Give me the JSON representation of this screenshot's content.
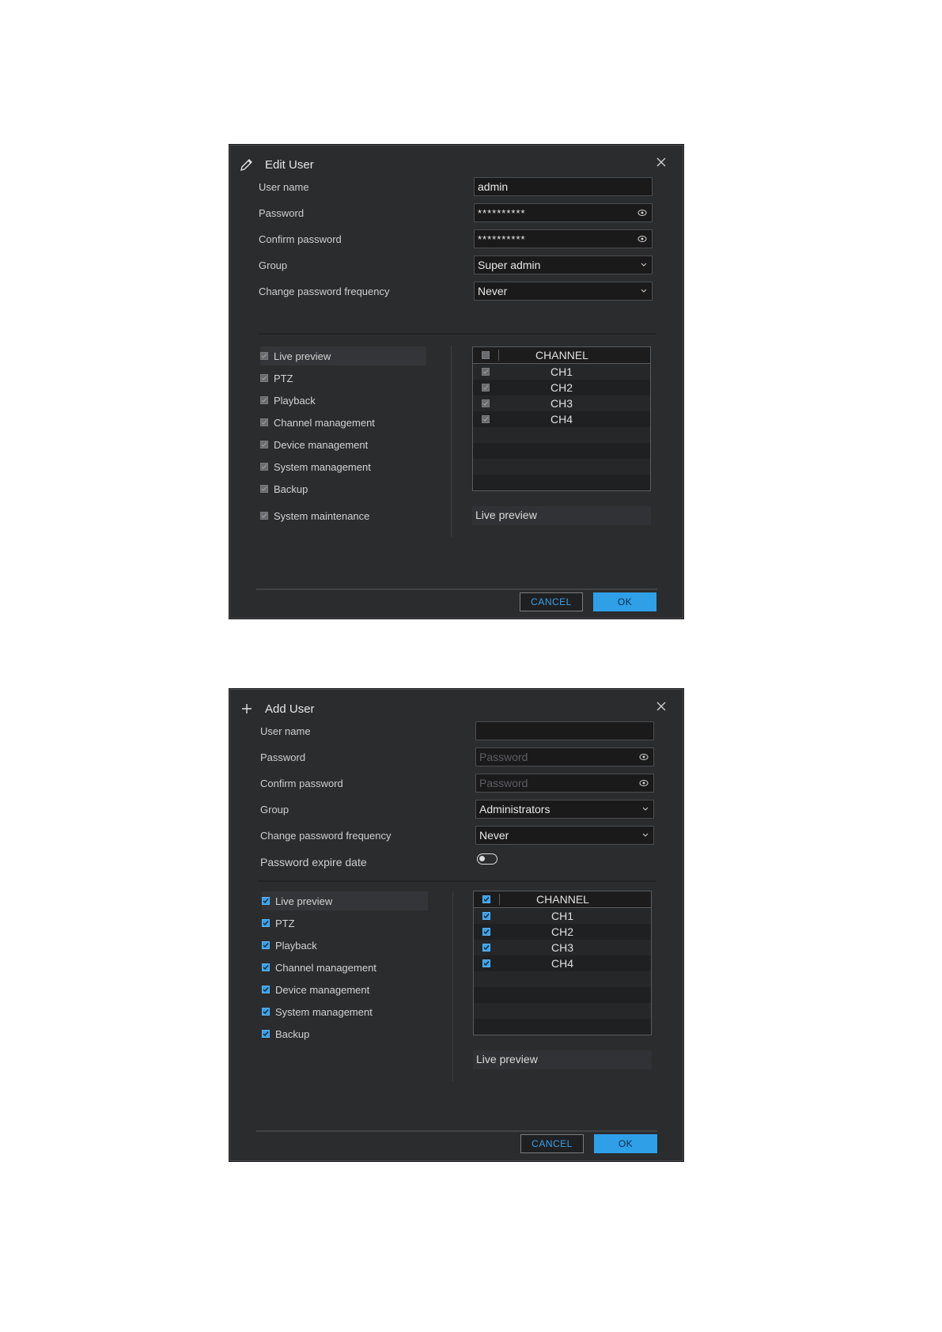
{
  "edit_dialog": {
    "title": "Edit User",
    "title_icon": "pencil-icon",
    "fields": {
      "username_label": "User name",
      "username_value": "admin",
      "password_label": "Password",
      "password_value": "**********",
      "confirm_label": "Confirm password",
      "confirm_value": "**********",
      "group_label": "Group",
      "group_value": "Super admin",
      "frequency_label": "Change password frequency",
      "frequency_value": "Never"
    },
    "permissions": [
      "Live preview",
      "PTZ",
      "Playback",
      "Channel management",
      "Device management",
      "System management",
      "Backup",
      "System maintenance"
    ],
    "permission_checked": false,
    "channel_header": "CHANNEL",
    "channels": [
      "CH1",
      "CH2",
      "CH3",
      "CH4"
    ],
    "info": "Live preview",
    "cancel_label": "CANCEL",
    "ok_label": "OK"
  },
  "add_dialog": {
    "title": "Add User",
    "title_icon": "plus-icon",
    "fields": {
      "username_label": "User name",
      "username_value": "",
      "password_label": "Password",
      "password_placeholder": "Password",
      "confirm_label": "Confirm password",
      "confirm_placeholder": "Password",
      "group_label": "Group",
      "group_value": "Administrators",
      "frequency_label": "Change password frequency",
      "frequency_value": "Never",
      "expire_label": "Password expire date",
      "expire_enabled": false
    },
    "permissions": [
      "Live preview",
      "PTZ",
      "Playback",
      "Channel management",
      "Device management",
      "System management",
      "Backup"
    ],
    "permission_checked": true,
    "channel_header": "CHANNEL",
    "channels": [
      "CH1",
      "CH2",
      "CH3",
      "CH4"
    ],
    "info": "Live preview",
    "cancel_label": "CANCEL",
    "ok_label": "OK"
  },
  "colors": {
    "dialog_bg": "#2b2c2e",
    "accent": "#2f9fe8",
    "checkbox_checked": "#3aa0e8",
    "checkbox_disabled": "#6a6b6e"
  }
}
